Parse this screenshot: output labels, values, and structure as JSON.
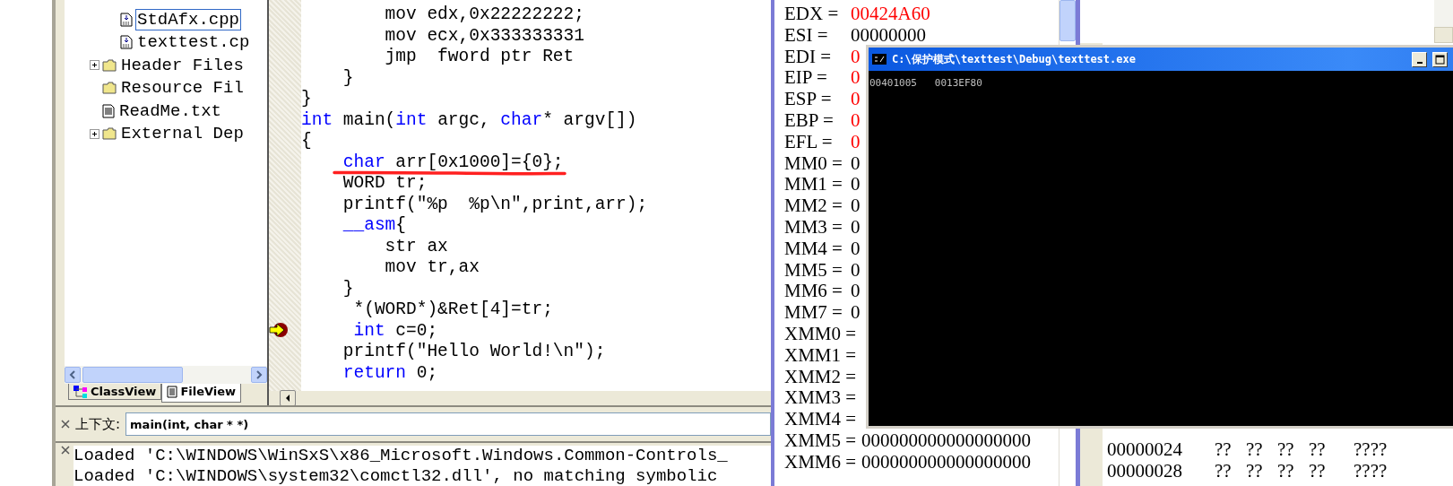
{
  "ide": {
    "file_tree": {
      "items": [
        {
          "children": [
            {
              "label": "StdAfx.cpp",
              "kind": "source",
              "expandable": false,
              "selected": true
            },
            {
              "label": "texttest.cp",
              "kind": "source",
              "expandable": false,
              "selected": false
            }
          ]
        },
        {
          "label": "Header Files",
          "kind": "folder",
          "expandable": true,
          "selected": false
        },
        {
          "label": "Resource Fil",
          "kind": "folder",
          "expandable": false,
          "selected": false
        },
        {
          "label": "ReadMe.txt",
          "kind": "text",
          "expandable": false,
          "selected": false
        },
        {
          "label": "External Dep",
          "kind": "folder",
          "expandable": true,
          "selected": false
        }
      ]
    },
    "tabs": [
      {
        "label": "ClassView",
        "kind": "classes",
        "selected": false
      },
      {
        "label": "FileView",
        "kind": "files",
        "selected": true
      }
    ],
    "code_lines": [
      {
        "tokens": [
          {
            "text": "        mov edx,0x22222222;",
            "kind": "plain"
          }
        ],
        "underlined": false,
        "current": false
      },
      {
        "tokens": [
          {
            "text": "        mov ecx,0x333333331",
            "kind": "plain"
          }
        ],
        "underlined": false,
        "current": false
      },
      {
        "tokens": [
          {
            "text": "        jmp  fword ptr Ret",
            "kind": "plain"
          }
        ],
        "underlined": false,
        "current": false
      },
      {
        "tokens": [
          {
            "text": "    }",
            "kind": "plain"
          }
        ],
        "underlined": false,
        "current": false
      },
      {
        "tokens": [
          {
            "text": "}",
            "kind": "plain"
          }
        ],
        "underlined": false,
        "current": false
      },
      {
        "tokens": [
          {
            "text": "int",
            "kind": "keyword"
          },
          {
            "text": " main(",
            "kind": "plain"
          },
          {
            "text": "int",
            "kind": "keyword"
          },
          {
            "text": " argc, ",
            "kind": "plain"
          },
          {
            "text": "char",
            "kind": "keyword"
          },
          {
            "text": "* argv[])",
            "kind": "plain"
          }
        ],
        "underlined": false,
        "current": false
      },
      {
        "tokens": [
          {
            "text": "{",
            "kind": "plain"
          }
        ],
        "underlined": false,
        "current": false
      },
      {
        "tokens": [
          {
            "text": "    char",
            "kind": "keyword"
          },
          {
            "text": " arr[0x1000]={0};",
            "kind": "plain"
          }
        ],
        "underlined": true,
        "current": false
      },
      {
        "tokens": [
          {
            "text": "    WORD tr;",
            "kind": "plain"
          }
        ],
        "underlined": false,
        "current": false
      },
      {
        "tokens": [
          {
            "text": "    printf(\"%p  %p\\n\",print,arr);",
            "kind": "plain"
          }
        ],
        "underlined": false,
        "current": false
      },
      {
        "tokens": [
          {
            "text": "    __asm",
            "kind": "keyword"
          },
          {
            "text": "{",
            "kind": "plain"
          }
        ],
        "underlined": false,
        "current": false
      },
      {
        "tokens": [
          {
            "text": "        str ax",
            "kind": "plain"
          }
        ],
        "underlined": false,
        "current": false
      },
      {
        "tokens": [
          {
            "text": "        mov tr,ax",
            "kind": "plain"
          }
        ],
        "underlined": false,
        "current": false
      },
      {
        "tokens": [
          {
            "text": "    }",
            "kind": "plain"
          }
        ],
        "underlined": false,
        "current": false
      },
      {
        "tokens": [
          {
            "text": "     *(WORD*)&Ret[4]=tr;",
            "kind": "plain"
          }
        ],
        "underlined": false,
        "current": false
      },
      {
        "tokens": [
          {
            "text": "     int",
            "kind": "keyword"
          },
          {
            "text": " c=0;",
            "kind": "plain"
          }
        ],
        "underlined": false,
        "current": true
      },
      {
        "tokens": [
          {
            "text": "    printf(\"Hello World!\\n\");",
            "kind": "plain"
          }
        ],
        "underlined": false,
        "current": false
      },
      {
        "tokens": [
          {
            "text": "    return",
            "kind": "keyword"
          },
          {
            "text": " 0;",
            "kind": "plain"
          }
        ],
        "underlined": false,
        "current": false
      }
    ],
    "context": {
      "label": "上下文:",
      "value": "main(int, char * *)"
    },
    "output_lines": [
      "Loaded 'C:\\WINDOWS\\WinSxS\\x86_Microsoft.Windows.Common-Controls_",
      "Loaded 'C:\\WINDOWS\\system32\\comctl32.dll', no matching symbolic"
    ]
  },
  "registers": [
    {
      "label": "EDX =",
      "value": "00424A60",
      "color": "#ff0000"
    },
    {
      "label": "ESI =",
      "value": "00000000",
      "color": "#000000"
    },
    {
      "label": "EDI =",
      "value": "0",
      "color": "#ff0000"
    },
    {
      "label": "EIP =",
      "value": "0",
      "color": "#ff0000"
    },
    {
      "label": "ESP =",
      "value": "0",
      "color": "#ff0000"
    },
    {
      "label": "EBP =",
      "value": "0",
      "color": "#ff0000"
    },
    {
      "label": "EFL =",
      "value": "0",
      "color": "#ff0000"
    },
    {
      "label": "MM0 =",
      "value": "0",
      "color": "#000000"
    },
    {
      "label": "MM1 =",
      "value": "0",
      "color": "#000000"
    },
    {
      "label": "MM2 =",
      "value": "0",
      "color": "#000000"
    },
    {
      "label": "MM3 =",
      "value": "0",
      "color": "#000000"
    },
    {
      "label": "MM4 =",
      "value": "0",
      "color": "#000000"
    },
    {
      "label": "MM5 =",
      "value": "0",
      "color": "#000000"
    },
    {
      "label": "MM6 =",
      "value": "0",
      "color": "#000000"
    },
    {
      "label": "MM7 =",
      "value": "0",
      "color": "#000000"
    },
    {
      "label": "XMM0 ="
    },
    {
      "label": "XMM1 ="
    },
    {
      "label": "XMM2 ="
    },
    {
      "label": "XMM3 ="
    },
    {
      "label": "XMM4 ="
    },
    {
      "label": "XMM5 =",
      "value": "000000000000000000",
      "color": "#000000"
    },
    {
      "label": "XMM6 =",
      "value": "000000000000000000",
      "color": "#000000"
    }
  ],
  "console": {
    "title": "C:\\保护模式\\texttest\\Debug\\texttest.exe",
    "output": "00401005   0013EF80"
  },
  "memory": {
    "rows": [
      {
        "address": "00000024",
        "bytes": [
          "??",
          "??",
          "??",
          "??"
        ],
        "ascii": "????"
      },
      {
        "address": "00000028",
        "bytes": [
          "??",
          "??",
          "??",
          "??"
        ],
        "ascii": "????"
      }
    ]
  }
}
